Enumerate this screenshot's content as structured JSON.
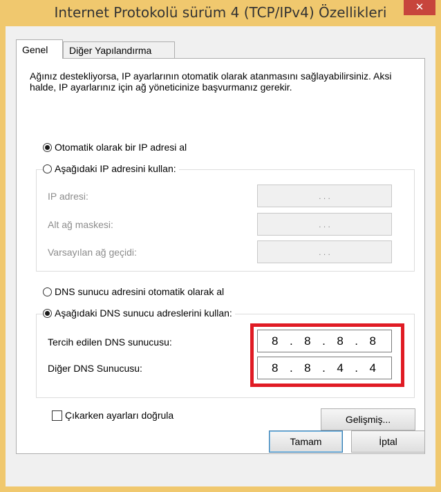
{
  "window": {
    "title": "Internet Protokolü sürüm 4 (TCP/IPv4) Özellikleri",
    "close_glyph": "✕"
  },
  "tabs": [
    {
      "label": "Genel"
    },
    {
      "label": "Diğer Yapılandırma"
    }
  ],
  "description": "Ağınız destekliyorsa, IP ayarlarının otomatik olarak atanmasını sağlayabilirsiniz. Aksi halde, IP ayarlarınız için ağ yöneticinize başvurmanız gerekir.",
  "ip_section": {
    "auto_radio": {
      "label": "Otomatik olarak bir IP adresi al",
      "checked": true
    },
    "manual_radio": {
      "label": "Aşağıdaki IP adresini kullan:",
      "checked": false
    },
    "fields": [
      {
        "label": "IP adresi:",
        "value": ". . ."
      },
      {
        "label": "Alt ağ maskesi:",
        "value": ". . ."
      },
      {
        "label": "Varsayılan ağ geçidi:",
        "value": ". . ."
      }
    ]
  },
  "dns_section": {
    "auto_radio": {
      "label": "DNS sunucu adresini otomatik olarak al",
      "checked": false
    },
    "manual_radio": {
      "label": "Aşağıdaki DNS sunucu adreslerini kullan:",
      "checked": true
    },
    "preferred": {
      "label": "Tercih edilen DNS sunucusu:",
      "octets": [
        "8",
        ".",
        "8",
        ".",
        "8",
        ".",
        "8"
      ]
    },
    "alternate": {
      "label": "Diğer DNS Sunucusu:",
      "octets": [
        "8",
        ".",
        "8",
        ".",
        "4",
        ".",
        "4"
      ]
    }
  },
  "validate_checkbox": {
    "label": "Çıkarken ayarları doğrula",
    "checked": false
  },
  "buttons": {
    "advanced": "Gelişmiş...",
    "ok": "Tamam",
    "cancel": "İptal"
  },
  "colors": {
    "highlight": "#e01b24",
    "close": "#c7453c",
    "frame": "#f0c86e"
  }
}
